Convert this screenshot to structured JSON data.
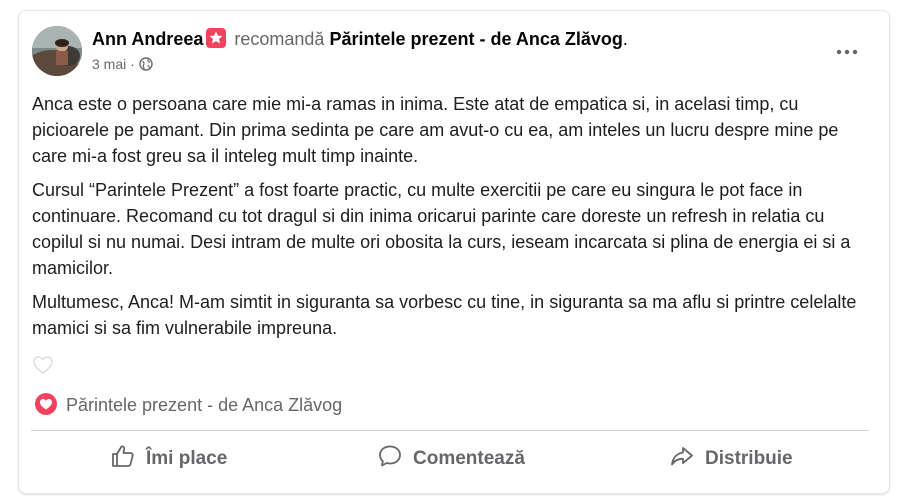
{
  "post": {
    "author": "Ann Andreea",
    "recommend_verb": "recomandă",
    "page_name": "Părintele prezent - de Anca Zlăvog",
    "page_name_punct": ".",
    "date": "3 mai",
    "date_separator": "·",
    "privacy_icon": "globe-icon",
    "more_icon": "more-options-icon",
    "paragraphs": [
      "Anca este o persoana care mie mi-a ramas in inima. Este atat de empatica si, in acelasi timp, cu picioarele pe pamant. Din prima sedinta pe care am avut-o cu ea,  am inteles un lucru despre mine pe care mi-a fost greu sa il inteleg mult timp inainte.",
      "Cursul “Parintele Prezent” a fost foarte practic, cu multe exercitii pe care eu singura le pot face in continuare. Recomand cu tot dragul si din inima oricarui parinte care doreste un refresh in relatia cu copilul si nu numai. Desi intram de multe ori obosita la curs, ieseam incarcata si plina de energia ei si a mamicilor.",
      "Multumesc, Anca! M-am simtit in siguranta sa vorbesc cu tine, in siguranta sa ma aflu si printre celelalte mamici si sa fim vulnerabile impreuna."
    ],
    "recommended_page": "Părintele prezent - de Anca Zlăvog"
  },
  "actions": {
    "like_label": "Îmi place",
    "comment_label": "Comentează",
    "share_label": "Distribuie"
  },
  "colors": {
    "recommend_badge": "#f3425f",
    "secondary_text": "#65676b",
    "divider": "#ced0d4"
  }
}
